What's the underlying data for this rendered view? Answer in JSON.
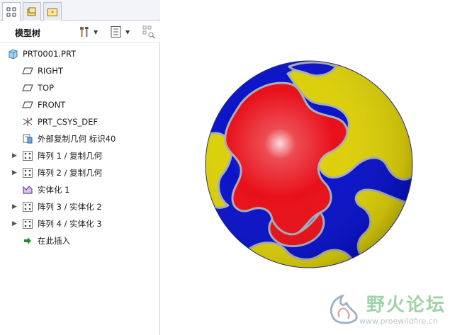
{
  "model_tree": {
    "title": "模型树",
    "items": [
      {
        "label": "PRT0001.PRT",
        "icon": "part-icon",
        "expandable": false
      },
      {
        "label": "RIGHT",
        "icon": "datum-plane-icon",
        "expandable": false
      },
      {
        "label": "TOP",
        "icon": "datum-plane-icon",
        "expandable": false
      },
      {
        "label": "FRONT",
        "icon": "datum-plane-icon",
        "expandable": false
      },
      {
        "label": "PRT_CSYS_DEF",
        "icon": "coordinate-system-icon",
        "expandable": false
      },
      {
        "label": "外部复制几何 标识40",
        "icon": "external-copy-geometry-icon",
        "expandable": false
      },
      {
        "label": "阵列 1 / 复制几何",
        "icon": "pattern-icon",
        "expandable": true
      },
      {
        "label": "阵列 2 / 复制几何",
        "icon": "pattern-icon",
        "expandable": true
      },
      {
        "label": "实体化 1",
        "icon": "solidify-icon",
        "expandable": false
      },
      {
        "label": "阵列 3 / 实体化 2",
        "icon": "pattern-icon",
        "expandable": true
      },
      {
        "label": "阵列 4 / 实体化 3",
        "icon": "pattern-icon",
        "expandable": true
      },
      {
        "label": "在此插入",
        "icon": "insert-here-arrow-icon",
        "expandable": false
      }
    ]
  },
  "tabs": [
    {
      "name": "model-tree-tab",
      "icon": "model-tree-icon",
      "active": true
    },
    {
      "name": "folder-browser-tab",
      "icon": "folder-icon",
      "active": false
    },
    {
      "name": "favorites-tab",
      "icon": "favorites-icon",
      "active": false
    }
  ],
  "toolbar": {
    "settings_icon": "tools-icon",
    "show_icon": "list-settings-icon",
    "filter_icon": "tree-filter-icon",
    "expander_glyph": "▶",
    "caret_glyph": "▼"
  },
  "watermark": {
    "site_name": "野火论坛",
    "url": "www.proewildfire.cn"
  },
  "colors": {
    "red": "#e8101a",
    "yellow": "#dccf0a",
    "blue": "#0a13c8",
    "tree_border": "#cfd6df",
    "watermark_green": "#9fd3a6"
  }
}
